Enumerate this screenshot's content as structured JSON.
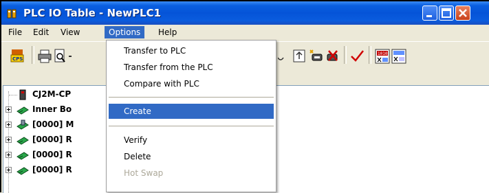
{
  "window": {
    "title": "PLC IO Table - NewPLC1",
    "colors": {
      "titlebar": "#0554d8",
      "highlight": "#316ac5",
      "close_button": "#c8401a"
    }
  },
  "menu": {
    "items": [
      {
        "label": "File"
      },
      {
        "label": "Edit"
      },
      {
        "label": "View"
      },
      {
        "label": "Options",
        "active": true
      },
      {
        "label": "Help"
      }
    ]
  },
  "dropdown": {
    "items": [
      {
        "label": "Transfer to PLC"
      },
      {
        "label": "Transfer from the PLC"
      },
      {
        "label": "Compare with PLC"
      },
      {
        "label": "Create",
        "highlighted": true
      },
      {
        "label": "Verify"
      },
      {
        "label": "Delete"
      },
      {
        "label": "Hot Swap",
        "disabled": true
      }
    ]
  },
  "toolbar": {
    "icons": [
      "cps-icon",
      "print-icon",
      "print-preview-icon",
      "io-table-icon",
      "transfer-icon",
      "new-unit-icon",
      "delete-unit-icon",
      "verify-check-icon",
      "io-compare-icon",
      "io-list-icon"
    ]
  },
  "tree": {
    "items": [
      {
        "label": "CJ2M-CP",
        "icon": "cpu-icon"
      },
      {
        "label": "Inner Bo",
        "icon": "board-icon"
      },
      {
        "label": "[0000] M",
        "icon": "main-rack-icon"
      },
      {
        "label": "[0000] R",
        "icon": "rack-icon"
      },
      {
        "label": "[0000] R",
        "icon": "rack-icon"
      },
      {
        "label": "[0000] R",
        "icon": "rack-icon"
      }
    ]
  }
}
